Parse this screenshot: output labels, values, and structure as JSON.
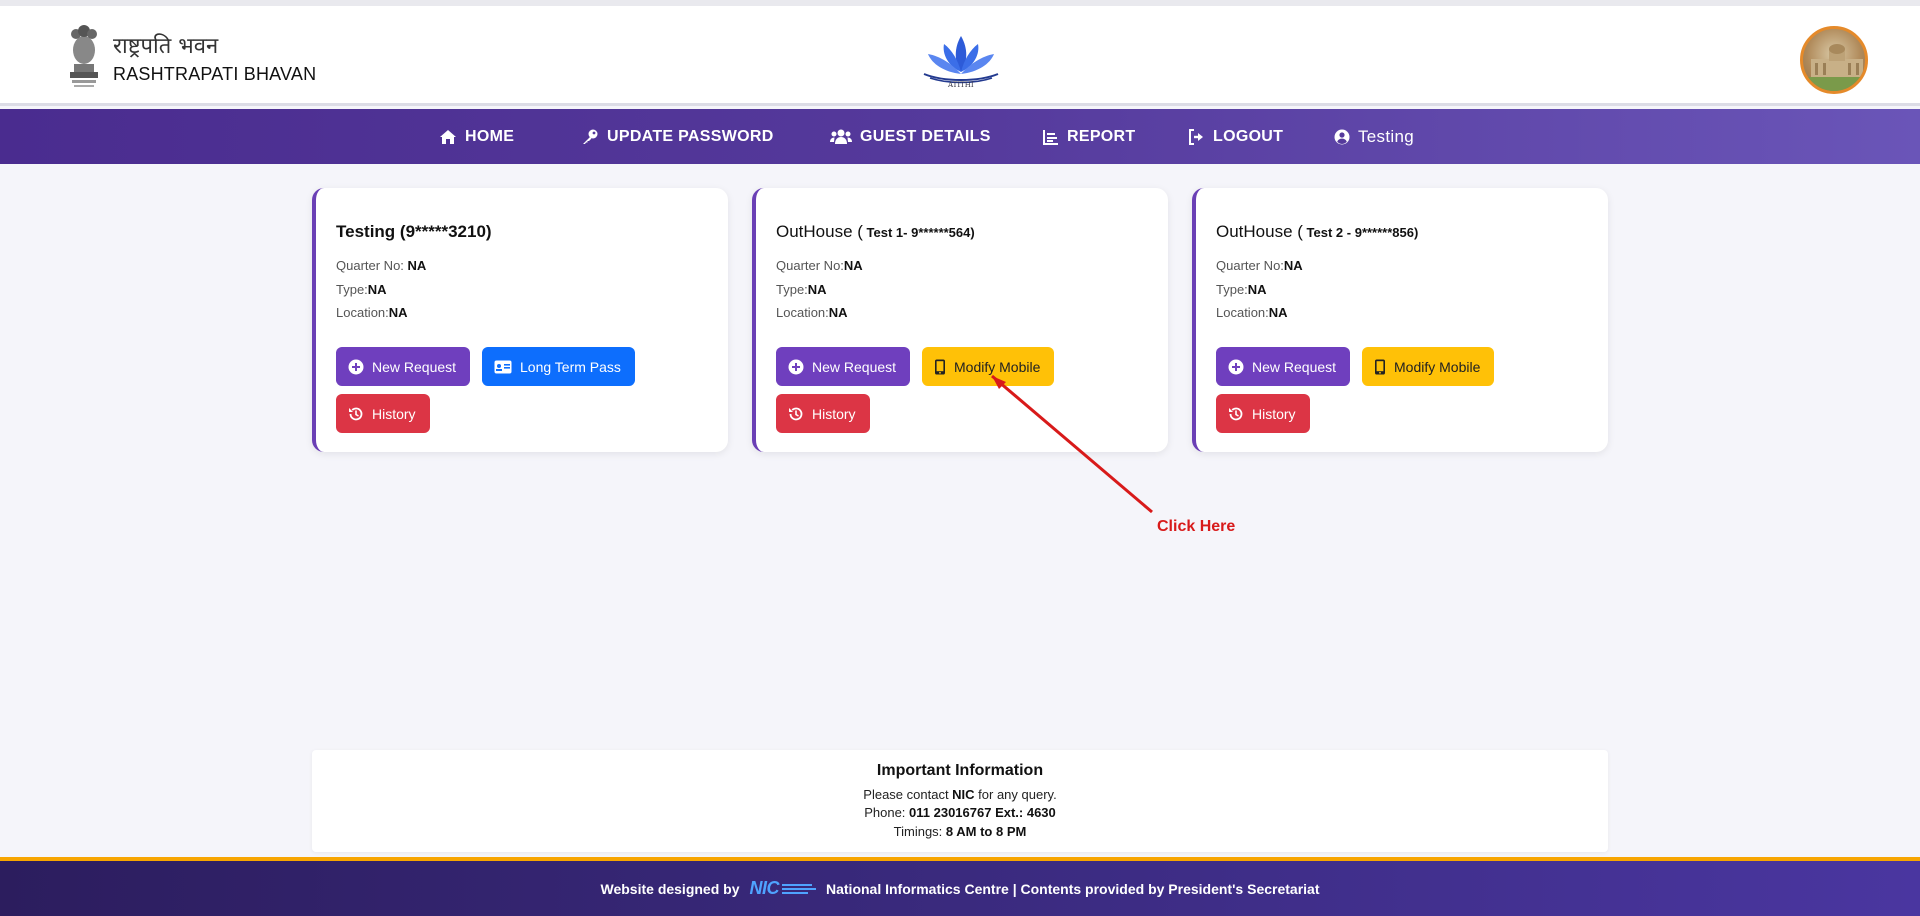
{
  "header": {
    "brand_hindi": "राष्ट्रपति भवन",
    "brand_english": "RASHTRAPATI BHAVAN",
    "logo_caption": "ATITHI"
  },
  "nav": {
    "home": "HOME",
    "update_password": "UPDATE PASSWORD",
    "guest_details": "GUEST DETAILS",
    "report": "REPORT",
    "logout": "LOGOUT",
    "user": "Testing"
  },
  "cards": [
    {
      "title_main": "Testing (9*****3210)",
      "quarter_label": "Quarter No:",
      "quarter_value": "NA",
      "type_label": "Type:",
      "type_value": "NA",
      "location_label": "Location:",
      "location_value": "NA",
      "btn_new": "New Request",
      "btn_second": "Long Term Pass",
      "btn_history": "History"
    },
    {
      "title_prefix": "OutHouse (",
      "title_detail": " Test 1- 9******564)",
      "quarter_label": "Quarter No:",
      "quarter_value": "NA",
      "type_label": "Type:",
      "type_value": "NA",
      "location_label": "Location:",
      "location_value": "NA",
      "btn_new": "New Request",
      "btn_second": "Modify Mobile",
      "btn_history": "History"
    },
    {
      "title_prefix": "OutHouse (",
      "title_detail": " Test 2 - 9******856)",
      "quarter_label": "Quarter No:",
      "quarter_value": "NA",
      "type_label": "Type:",
      "type_value": "NA",
      "location_label": "Location:",
      "location_value": "NA",
      "btn_new": "New Request",
      "btn_second": "Modify Mobile",
      "btn_history": "History"
    }
  ],
  "annotation": {
    "text": "Click Here",
    "color": "#d81a1a"
  },
  "info": {
    "title": "Important Information",
    "line1_pre": "Please contact ",
    "line1_bold": "NIC",
    "line1_post": " for any query.",
    "line2_pre": "Phone: ",
    "line2_bold": "011 23016767 Ext.: 4630",
    "line3_pre": "Timings: ",
    "line3_bold": "8 AM to 8 PM"
  },
  "footer": {
    "pre": "Website designed by",
    "nic": "NIC",
    "post": "National Informatics Centre | Contents provided by President's Secretariat"
  },
  "colors": {
    "nav": "#4a2c8f",
    "purple_btn": "#6f3fbe",
    "blue_btn": "#0d6efd",
    "yellow_btn": "#ffc107",
    "red_btn": "#dc3545",
    "footer_accent": "#f7a500"
  }
}
